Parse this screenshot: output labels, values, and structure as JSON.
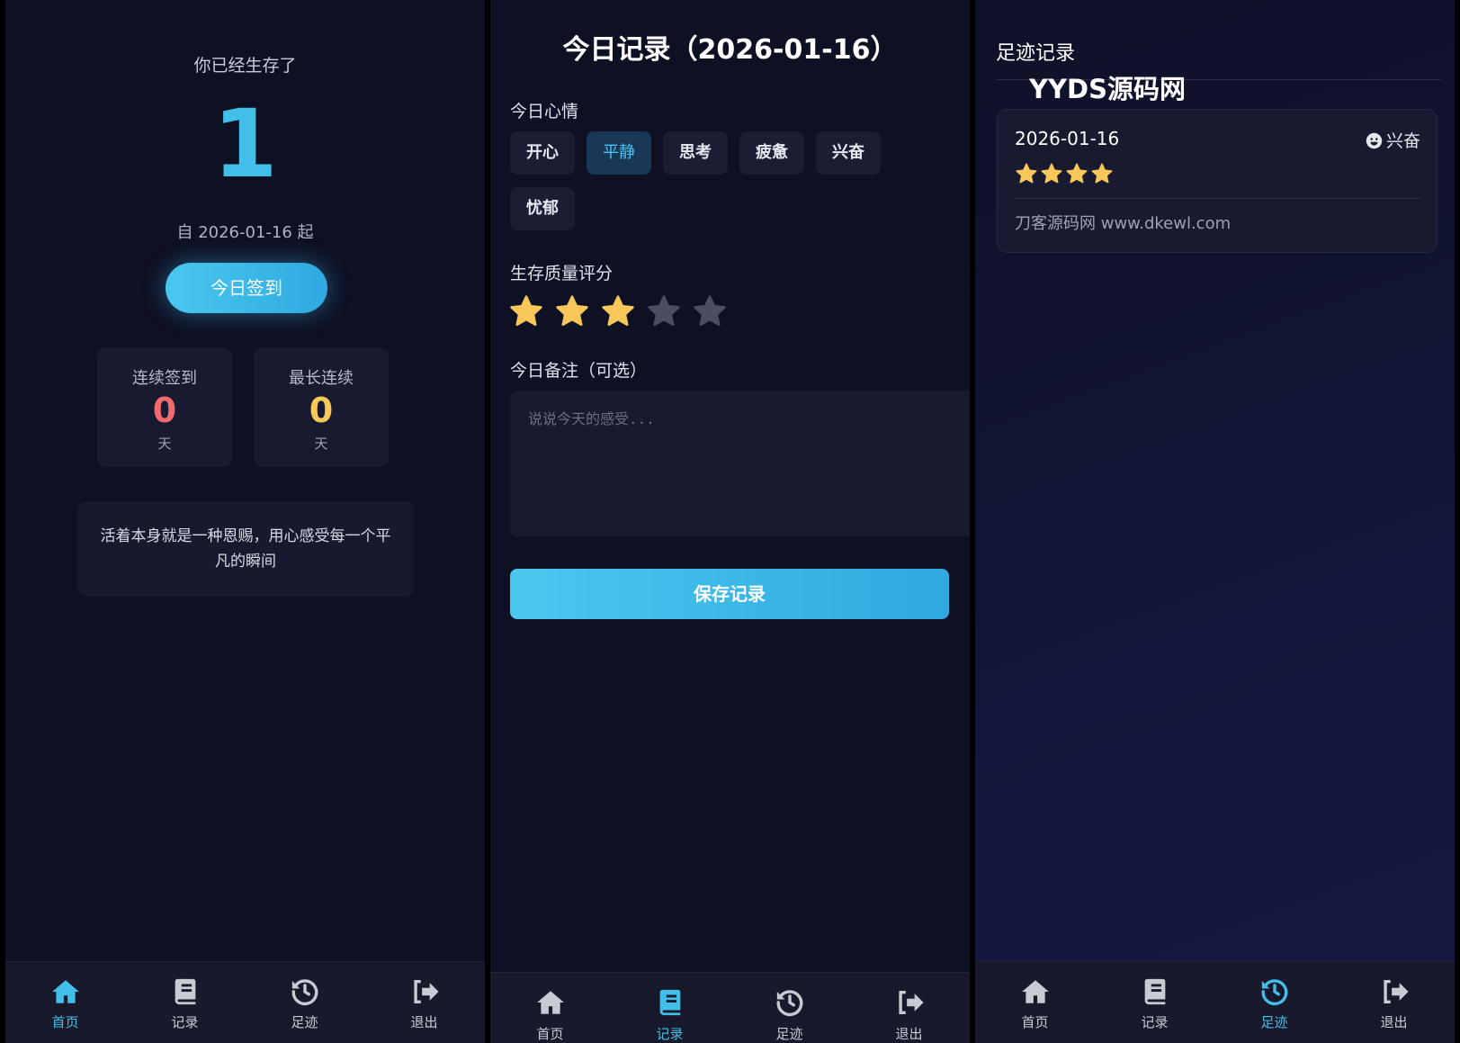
{
  "home": {
    "survived_label": "你已经生存了",
    "days": "1",
    "since": "自 2026-01-16 起",
    "checkin_button": "今日签到",
    "stats": [
      {
        "label": "连续签到",
        "value": "0",
        "unit": "天",
        "color": "#f06a6e"
      },
      {
        "label": "最长连续",
        "value": "0",
        "unit": "天",
        "color": "#f7c95a"
      }
    ],
    "quote": "活着本身就是一种恩赐，用心感受每一个平凡的瞬间"
  },
  "record": {
    "title": "今日记录（2026-01-16）",
    "mood_label": "今日心情",
    "moods": [
      "开心",
      "平静",
      "思考",
      "疲惫",
      "兴奋",
      "忧郁"
    ],
    "selected_mood": "平静",
    "rating_label": "生存质量评分",
    "rating": 3,
    "rating_max": 5,
    "note_label": "今日备注（可选）",
    "note_placeholder": "说说今天的感受...",
    "save_button": "保存记录"
  },
  "footprints": {
    "title": "足迹记录",
    "watermark": "YYDS源码网",
    "entries": [
      {
        "date": "2026-01-16",
        "mood": "兴奋",
        "mood_icon": "smile-icon",
        "rating": 4,
        "note": "刀客源码网 www.dkewl.com"
      }
    ]
  },
  "tabbar": {
    "items": [
      {
        "label": "首页",
        "icon": "home-icon"
      },
      {
        "label": "记录",
        "icon": "book-icon"
      },
      {
        "label": "足迹",
        "icon": "history-icon"
      },
      {
        "label": "退出",
        "icon": "logout-icon"
      }
    ],
    "active_by_panel": [
      "首页",
      "记录",
      "足迹"
    ]
  },
  "colors": {
    "accent": "#41bfe9",
    "star_on": "#f8c75a",
    "star_off": "#4b4e63",
    "background": "#0e1024"
  }
}
